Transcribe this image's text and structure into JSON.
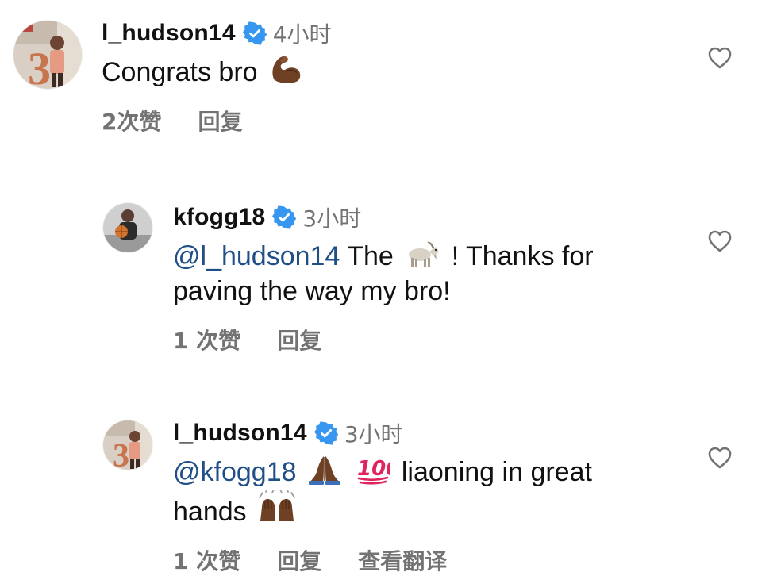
{
  "comments": [
    {
      "username": "l_hudson14",
      "time": "4小时",
      "text": "Congrats bro",
      "emoji": "flexed-biceps-emoji",
      "likes": "2次赞",
      "reply": "回复"
    },
    {
      "username": "kfogg18",
      "time": "3小时",
      "mention": "@l_hudson14",
      "text_before": "The",
      "emoji": "goat-emoji",
      "text_after_line1": "! Thanks for",
      "text_line2": "paving the way my bro!",
      "likes": "1 次赞",
      "reply": "回复"
    },
    {
      "username": "l_hudson14",
      "time": "3小时",
      "mention": "@kfogg18",
      "emoji_1": "folded-hands-emoji",
      "emoji_2": "hundred-points-emoji",
      "text_after": "liaoning in great",
      "text_line2": "hands",
      "emoji_3": "raising-hands-emoji",
      "likes": "1 次赞",
      "reply": "回复",
      "translate": "查看翻译"
    }
  ],
  "colors": {
    "verified_badge": "#3797f0",
    "mention": "#1f4f86",
    "secondary_text": "#737373"
  }
}
